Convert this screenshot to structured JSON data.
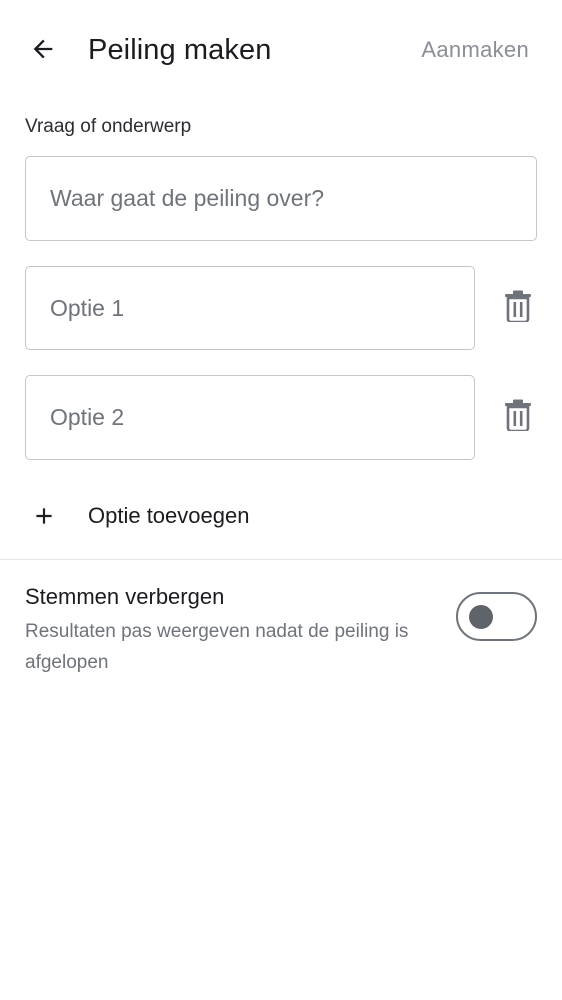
{
  "header": {
    "back_icon": "arrow-back-icon",
    "title": "Peiling maken",
    "create_label": "Aanmaken"
  },
  "question": {
    "label": "Vraag of onderwerp",
    "placeholder": "Waar gaat de peiling over?",
    "value": ""
  },
  "options": [
    {
      "placeholder": "Optie 1",
      "value": "",
      "delete_icon": "trash-icon"
    },
    {
      "placeholder": "Optie 2",
      "value": "",
      "delete_icon": "trash-icon"
    }
  ],
  "add_option": {
    "icon": "plus-icon",
    "label": "Optie toevoegen"
  },
  "hide_votes": {
    "title": "Stemmen verbergen",
    "description": "Resultaten pas weergeven nadat de peiling is afgelopen",
    "enabled": false
  },
  "colors": {
    "text_primary": "#1b1c1f",
    "text_secondary": "#6f737a",
    "disabled_action": "#8a8e95",
    "border": "#c4c6cb",
    "divider": "#e6e7ea"
  }
}
